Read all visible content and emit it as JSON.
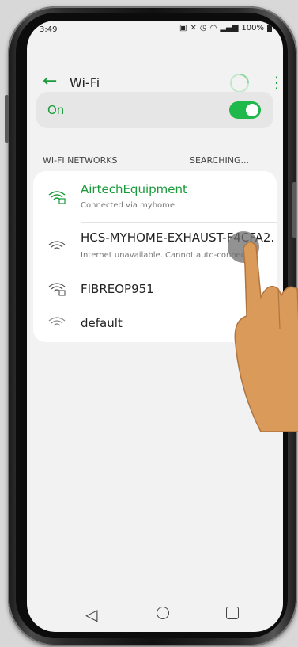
{
  "status_bar": {
    "time": "3:49",
    "battery": "100%"
  },
  "appbar": {
    "title": "Wi-Fi"
  },
  "wifi_toggle": {
    "label": "On",
    "state": "on"
  },
  "section": {
    "title": "WI-FI NETWORKS",
    "status": "SEARCHING..."
  },
  "networks": [
    {
      "name": "AirtechEquipment",
      "sub": "Connected via myhome",
      "connected": true,
      "icon": "wifi-locked-icon"
    },
    {
      "name": "HCS-MYHOME-EXHAUST-F4CFA2..",
      "sub": "Internet unavailable. Cannot auto-connect.",
      "connected": false,
      "icon": "wifi-icon"
    },
    {
      "name": "FIBREOP951",
      "sub": "",
      "connected": false,
      "icon": "wifi-locked-icon"
    },
    {
      "name": "default",
      "sub": "",
      "connected": false,
      "icon": "wifi-icon"
    }
  ],
  "colors": {
    "accent": "#1a9a3a",
    "toggle_on": "#1fb84a",
    "background": "#f2f2f2"
  }
}
